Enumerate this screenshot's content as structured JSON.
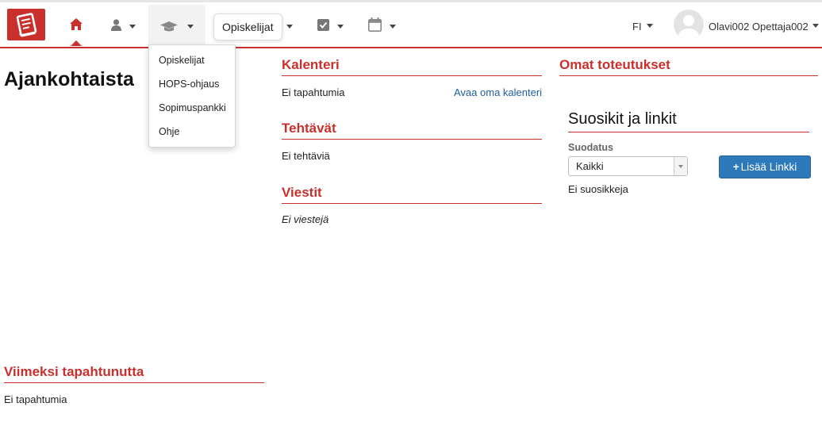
{
  "navbar": {
    "tooltip": "Opiskelijat",
    "language": "FI",
    "username": "Olavi002 Opettaja002",
    "icons": [
      "book-logo",
      "home",
      "user",
      "graduation-cap",
      "checkbox",
      "calendar"
    ]
  },
  "dropdown": {
    "items": [
      "Opiskelijat",
      "HOPS-ohjaus",
      "Sopimuspankki",
      "Ohje"
    ]
  },
  "left": {
    "title": "Ajankohtaista",
    "recent": {
      "heading": "Viimeksi tapahtunutta",
      "empty": "Ei tapahtumia"
    }
  },
  "middle": {
    "calendar": {
      "heading": "Kalenteri",
      "empty": "Ei tapahtumia",
      "link": "Avaa oma kalenteri"
    },
    "tasks": {
      "heading": "Tehtävät",
      "empty": "Ei tehtäviä"
    },
    "messages": {
      "heading": "Viestit",
      "empty": "Ei viestejä"
    }
  },
  "right": {
    "implementations": {
      "heading": "Omat toteutukset"
    },
    "favorites": {
      "title": "Suosikit ja linkit",
      "filter_label": "Suodatus",
      "filter_value": "Kaikki",
      "add_button": "Lisää Linkki",
      "empty": "Ei suosikkeja"
    }
  },
  "colors": {
    "accent": "#c9302c",
    "link": "#1f5e9e",
    "button": "#2e79b9"
  }
}
